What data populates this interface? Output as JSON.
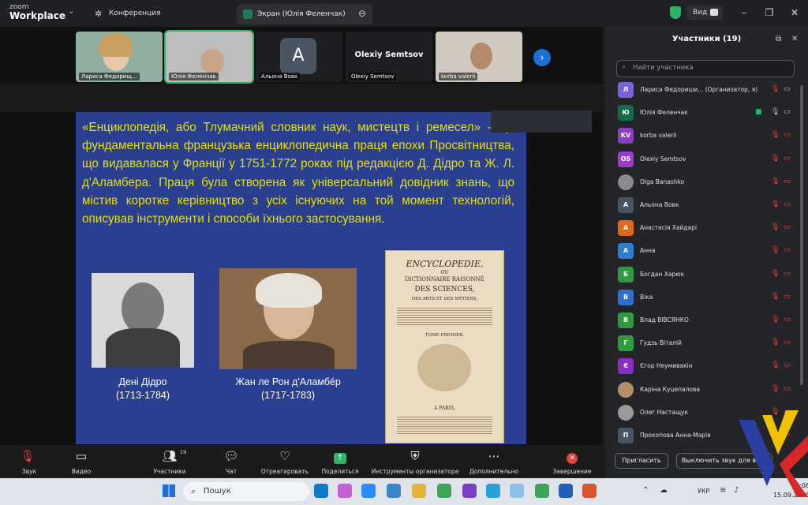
{
  "titlebar": {
    "app_small": "zoom",
    "app_name": "Workplace",
    "tab_conference": "Конференция",
    "tab_screen": "Экран (Юлія Феленчак)",
    "view_label": "Вид"
  },
  "thumbnails": [
    {
      "name": "Лариса Федорищ..."
    },
    {
      "name": "Юлія Феленчак"
    },
    {
      "name": "Альона Вовк",
      "initial": "A"
    },
    {
      "name": "Olexiy Semtsov",
      "big_label": "Olexiy Semtsov"
    },
    {
      "name": "korba valerii"
    }
  ],
  "slide": {
    "paragraph": "«Енциклопедія, або Тлумачний словник наук, мистецтв і ремесел» – це фундаментальна французька енциклопедична праця епохи Просвітництва, що видавалася у Франції у 1751-1772 роках під редакцією Д. Дідро та Ж. Л. д'Аламбера. Праця була створена як універсальний довідник знань, що містив коротке керівництво з усіх існуючих на той момент технологій, описував інструменти і способи їхнього застосування.",
    "caption1_name": "Дені Дідро",
    "caption1_years": "(1713-1784)",
    "caption2_name": "Жан ле Рон д'Аламбéр",
    "caption2_years": "(1717-1783)",
    "book_title": "ENCYCLOPEDIE,",
    "book_ou": "OU",
    "book_line2": "DICTIONNAIRE RAISONNÉ",
    "book_line3": "DES SCIENCES,",
    "book_line4": "DES ARTS ET DES MÉTIERS,",
    "book_tome": "TOME PREMIER.",
    "book_city": "A PARIS,"
  },
  "toolbar": {
    "sound": "Звук",
    "video": "Видео",
    "participants": "Участники",
    "participants_count": "19",
    "chat": "Чат",
    "react": "Отреагировать",
    "share": "Поделиться",
    "host_tools": "Инструменты организатора",
    "more": "Дополнительно",
    "end": "Завершение"
  },
  "panel": {
    "title": "Участники (19)",
    "search_placeholder": "Найти участника",
    "participants": [
      {
        "initial": "Л",
        "name": "Лариса Федориши... (Организатор, я)",
        "color": "#7b61d6"
      },
      {
        "initial": "Ю",
        "name": "Юлія Феленчак",
        "color": "#0f6b48"
      },
      {
        "initial": "KV",
        "name": "korba valerii",
        "color": "#8a3fc4"
      },
      {
        "initial": "OS",
        "name": "Olexiy Semtsov",
        "color": "#9a3ec8"
      },
      {
        "initial": "",
        "name": "Olga Banashko",
        "color": "#8b8b8b"
      },
      {
        "initial": "А",
        "name": "Альона Вовк",
        "color": "#4a5564"
      },
      {
        "initial": "А",
        "name": "Анастасія Хайдарі",
        "color": "#e06a1a"
      },
      {
        "initial": "А",
        "name": "Анна",
        "color": "#2e7ed1"
      },
      {
        "initial": "Б",
        "name": "Богдан Харюк",
        "color": "#2f9a3e"
      },
      {
        "initial": "В",
        "name": "Віка",
        "color": "#2e6fd0"
      },
      {
        "initial": "В",
        "name": "Влад ВІВСЯНКО",
        "color": "#2f9a3e"
      },
      {
        "initial": "Г",
        "name": "Гудзь Віталій",
        "color": "#2f9a3e"
      },
      {
        "initial": "Є",
        "name": "Єгор Неумивакін",
        "color": "#8a2fc4"
      },
      {
        "initial": "",
        "name": "Каріна Куцепалова",
        "color": "#b58e6a"
      },
      {
        "initial": "",
        "name": "Олег Настащук",
        "color": "#9a9a9a"
      },
      {
        "initial": "П",
        "name": "Прокопова Анна-Марія",
        "color": "#4a5564"
      }
    ],
    "invite": "Пригласить",
    "mute_all": "Выключить звук для всех"
  },
  "taskbar": {
    "search": "Пошук",
    "lang": "УКР",
    "time": "15:08",
    "date": "15.09.2025"
  }
}
